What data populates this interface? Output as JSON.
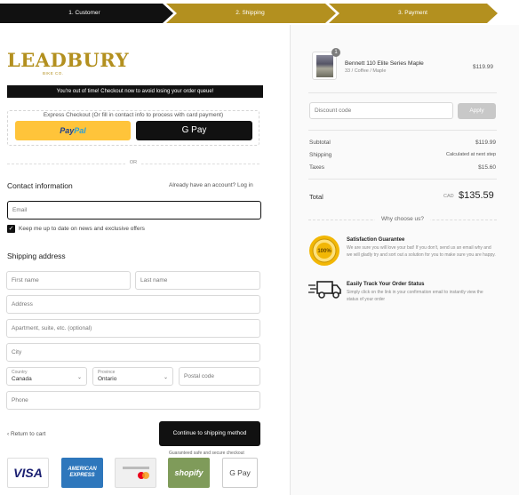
{
  "breadcrumb": {
    "steps": [
      "1. Customer",
      "2. Shipping",
      "3. Payment"
    ],
    "active_color": "#111111",
    "inactive_color": "#b3901f"
  },
  "brand": {
    "name": "LEADBURY",
    "tagline": "BIKE CO."
  },
  "banner": {
    "text": "You're out of time! Checkout now to avoid losing your order queue!"
  },
  "express": {
    "title": "Express Checkout (Or fill in contact info to process with card payment)",
    "paypal_label_1": "Pay",
    "paypal_label_2": "Pal",
    "gpay_label": "G Pay"
  },
  "or_text": "OR",
  "contact": {
    "title": "Contact information",
    "login_prompt": "Already have an account? Log in",
    "email_placeholder": "Email",
    "newsletter_label": "Keep me up to date on news and exclusive offers",
    "newsletter_checked": true
  },
  "shipping": {
    "title": "Shipping address",
    "first_name_placeholder": "First name",
    "last_name_placeholder": "Last name",
    "address_placeholder": "Address",
    "apartment_placeholder": "Apartment, suite, etc. (optional)",
    "city_placeholder": "City",
    "country_label": "Country",
    "country_value": "Canada",
    "province_label": "Province",
    "province_value": "Ontario",
    "postal_placeholder": "Postal code",
    "phone_placeholder": "Phone"
  },
  "footer": {
    "return_link": "Return to cart",
    "continue_label": "Continue to shipping method",
    "guarantee_text": "Guaranteed safe and secure checkout",
    "badges": {
      "visa": "VISA",
      "amex_1": "AMERICAN",
      "amex_2": "EXPRESS",
      "shopify": "shopify",
      "gpay": "G Pay"
    }
  },
  "cart": {
    "product_name": "Bennett 110 Elite Series Maple",
    "product_variant": "33 / Coffee / Maple",
    "product_price": "$119.99",
    "quantity": "1",
    "discount_placeholder": "Discount code",
    "apply_label": "Apply",
    "subtotal_label": "Subtotal",
    "subtotal_value": "$119.99",
    "shipping_label": "Shipping",
    "shipping_value": "Calculated at next step",
    "taxes_label": "Taxes",
    "taxes_value": "$15.60",
    "total_label": "Total",
    "total_currency": "CAD",
    "total_value": "$135.59"
  },
  "why": {
    "title": "Why choose us?",
    "features": [
      {
        "title": "Satisfaction Guarantee",
        "desc": "We are sure you will love your bat! If you don't, send us an email why and we will gladly try and sort out a solution for you to make sure you are happy.",
        "icon": "guarantee-seal-icon",
        "seal_text": "100%"
      },
      {
        "title": "Easily Track Your Order Status",
        "desc": "Simply click on the link in your confirmation email to instantly view the status of your order",
        "icon": "delivery-truck-icon"
      }
    ]
  }
}
